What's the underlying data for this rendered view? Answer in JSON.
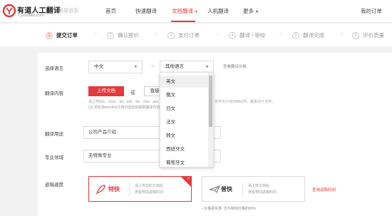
{
  "header": {
    "brand_name": "有道人工翻译",
    "brand_sub": "f.youdao.com",
    "brand_sep": "网易自营",
    "nav": [
      {
        "label": "首页"
      },
      {
        "label": "快速翻译"
      },
      {
        "label": "文档翻译",
        "active": true
      },
      {
        "label": "人机翻译"
      },
      {
        "label": "更多"
      }
    ],
    "my_orders": "我的订单"
  },
  "steps": [
    {
      "num": "1",
      "label": "提交订单",
      "active": true
    },
    {
      "num": "2",
      "label": "确认报价"
    },
    {
      "num": "3",
      "label": "支付订单"
    },
    {
      "num": "4",
      "label": "翻译 / 审校"
    },
    {
      "num": "5",
      "label": "翻译完成"
    },
    {
      "num": "6",
      "label": "评价质量"
    }
  ],
  "form": {
    "language_label": "选择语言",
    "source_lang": "中文",
    "target_lang": "其他语言",
    "price_link": "查看翻译价格",
    "content_label": "翻译内容",
    "upload_button": "上传文档",
    "or_text": "或",
    "paste_button": "直接",
    "upload_note_1": "请上传doc、docx、txt、pdf、xls、xlsx、ppt、pptx、png、jpg、gif格式的文件，文件大小在50M以内，最多10个文件。",
    "upload_note_2": "(注:现支持word/txt文档可选自动提取翻译内容)",
    "purpose_label": "翻译用途",
    "purpose_value": "公司产品介绍",
    "field_label": "专业领域",
    "field_value": "无特殊专业",
    "speed_label": "返稿速度",
    "speed_options": [
      {
        "name": "特快",
        "line1": "请上传您的文档后",
        "line2": "查看预估返稿时间",
        "selected": true
      },
      {
        "name": "普快",
        "line1": "请上传文档后",
        "line2": "查看预估返稿时间",
        "selected": false
      }
    ],
    "speed_link": "查询返稿时间",
    "price_note": "• 价格更实惠, 仅为特快价格的60%"
  },
  "dropdown": {
    "options": [
      "英文",
      "俄文",
      "日文",
      "法文",
      "韩文",
      "西班牙文",
      "葡萄牙文"
    ],
    "highlighted_index": 0
  },
  "colors": {
    "accent": "#e4393c",
    "background": "#f2f2f2"
  },
  "icons": {
    "logo": "youdao-logo-icon",
    "express": "rocket-icon",
    "normal": "airplane-icon"
  }
}
